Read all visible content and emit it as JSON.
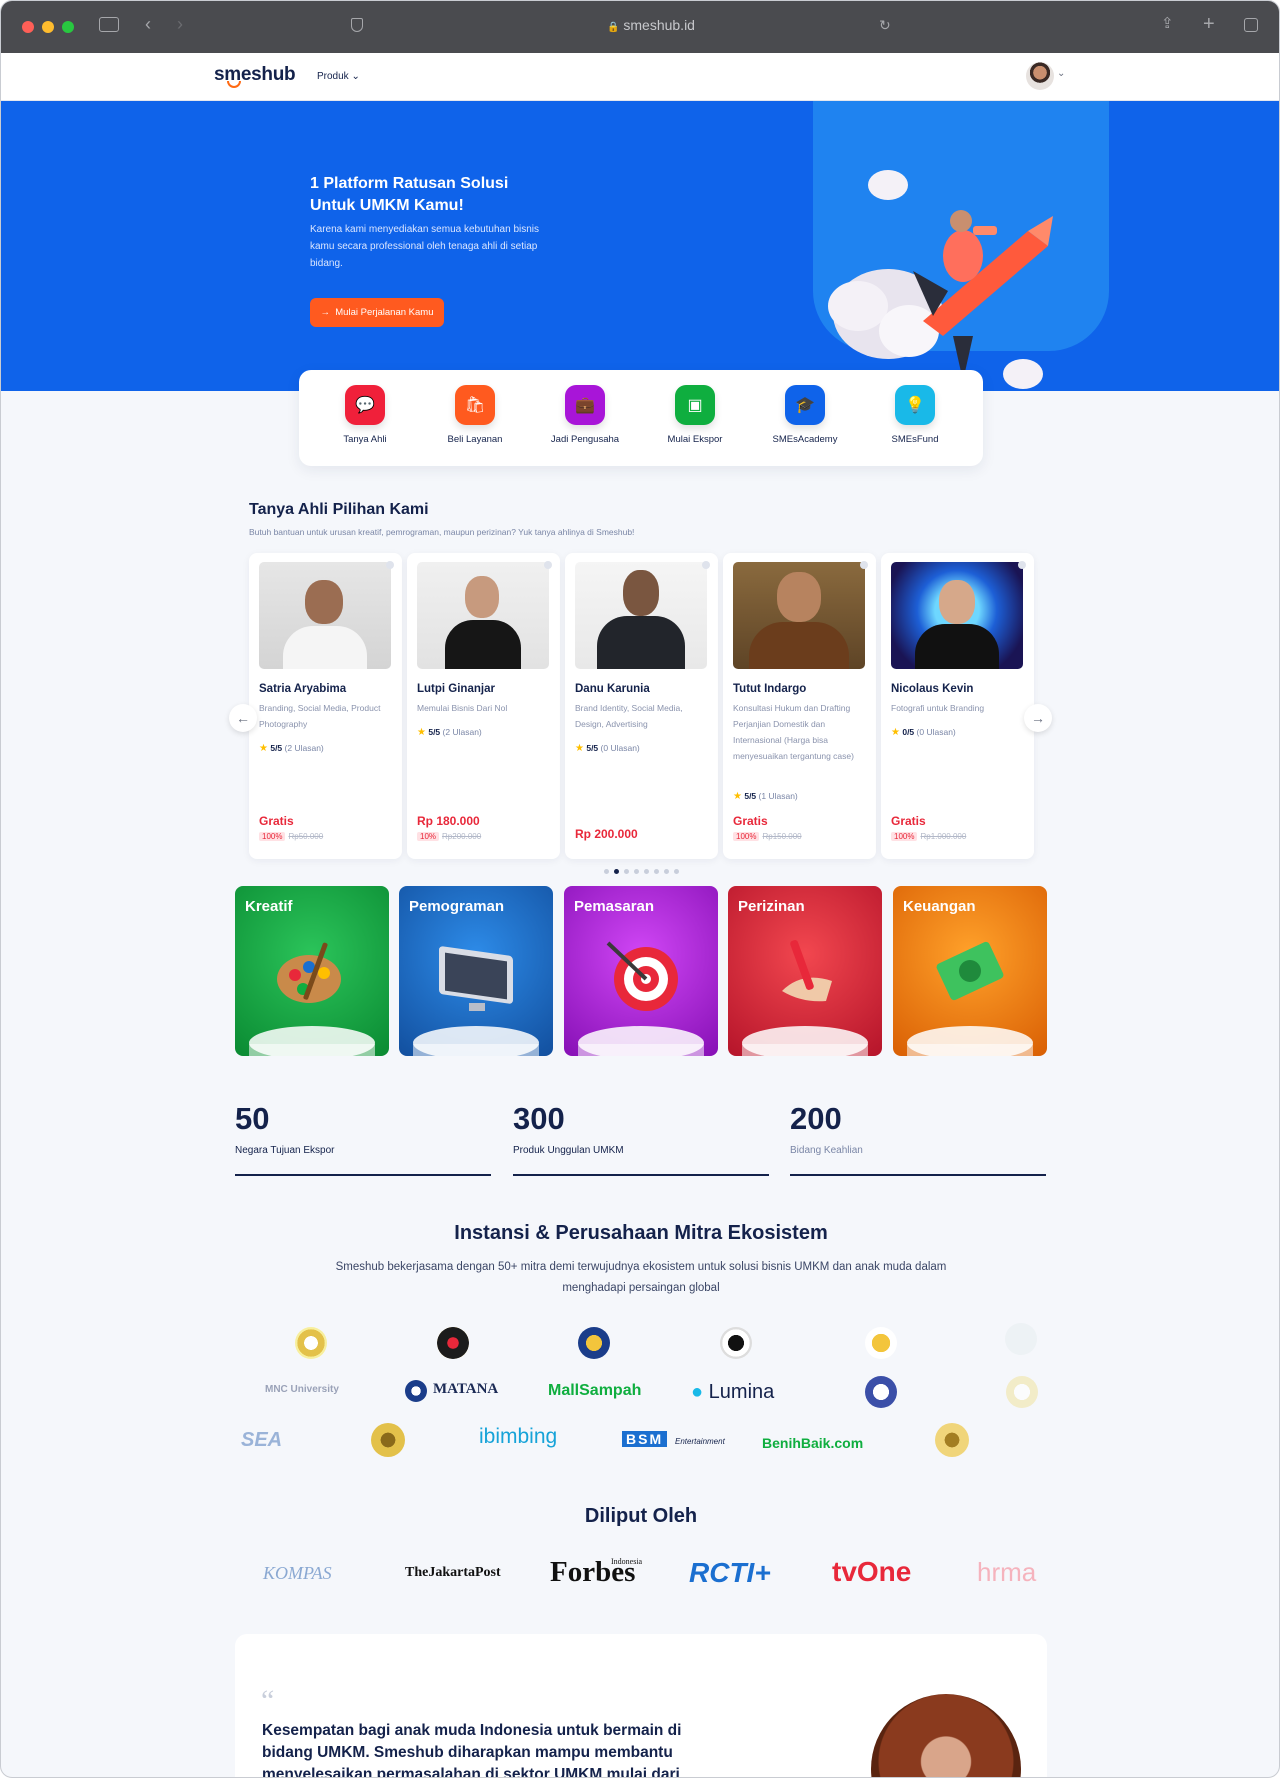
{
  "browser": {
    "url": "smeshub.id"
  },
  "nav": {
    "logo": "smeshub",
    "produk": "Produk",
    "produk_chevron": "⌄"
  },
  "hero": {
    "title": "1 Platform Ratusan Solusi Untuk UMKM Kamu!",
    "subtitle": "Karena kami menyediakan semua kebutuhan bisnis kamu secara professional oleh tenaga ahli di setiap bidang.",
    "cta": "Mulai Perjalanan Kamu"
  },
  "services": [
    {
      "label": "Tanya Ahli",
      "color": "#f0203a",
      "icon": "chat-icon"
    },
    {
      "label": "Beli Layanan",
      "color": "#ff5a1f",
      "icon": "shopping-bag-icon"
    },
    {
      "label": "Jadi Pengusaha",
      "color": "#a815d8",
      "icon": "briefcase-icon"
    },
    {
      "label": "Mulai Ekspor",
      "color": "#0fae3f",
      "icon": "box-icon"
    },
    {
      "label": "SMEsAcademy",
      "color": "#0f63ea",
      "icon": "graduation-cap-icon"
    },
    {
      "label": "SMEsFund",
      "color": "#19b9e8",
      "icon": "lightbulb-icon"
    }
  ],
  "experts": {
    "title": "Tanya Ahli Pilihan Kami",
    "subtitle": "Butuh bantuan untuk urusan kreatif, pemrograman, maupun perizinan? Yuk tanya ahlinya di Smeshub!",
    "cards": [
      {
        "name": "Satria Aryabima",
        "desc": "Branding, Social Media, Product Photography",
        "rating": "5/5",
        "reviews": "(2 Ulasan)",
        "price": "Gratis",
        "discount": "100%",
        "old_price": "Rp50.000"
      },
      {
        "name": "Lutpi Ginanjar",
        "desc": "Memulai Bisnis Dari Nol",
        "rating": "5/5",
        "reviews": "(2 Ulasan)",
        "price": "Rp 180.000",
        "discount": "10%",
        "old_price": "Rp200.000"
      },
      {
        "name": "Danu Karunia",
        "desc": "Brand Identity, Social Media, Design, Advertising",
        "rating": "5/5",
        "reviews": "(0 Ulasan)",
        "price": "Rp 200.000",
        "discount": "",
        "old_price": ""
      },
      {
        "name": "Tutut Indargo",
        "desc": "Konsultasi Hukum dan Drafting Perjanjian Domestik dan Internasional (Harga bisa menyesuaikan tergantung case)",
        "rating": "5/5",
        "reviews": "(1 Ulasan)",
        "price": "Gratis",
        "discount": "100%",
        "old_price": "Rp150.000"
      },
      {
        "name": "Nicolaus Kevin",
        "desc": "Fotografi untuk Branding",
        "rating": "0/5",
        "reviews": "(0 Ulasan)",
        "price": "Gratis",
        "discount": "100%",
        "old_price": "Rp1.000.000"
      }
    ],
    "page_count": 8,
    "active_page": 2
  },
  "categories": [
    {
      "label": "Kreatif",
      "color": "#10a53e"
    },
    {
      "label": "Pemograman",
      "color": "#1b6fd0"
    },
    {
      "label": "Pemasaran",
      "color": "#b51be0"
    },
    {
      "label": "Perizinan",
      "color": "#e02a3f"
    },
    {
      "label": "Keuangan",
      "color": "#f57c0a"
    }
  ],
  "stats": [
    {
      "value": "50",
      "label": "Negara Tujuan Ekspor"
    },
    {
      "value": "300",
      "label": "Produk Unggulan UMKM"
    },
    {
      "value": "200",
      "label": "Bidang Keahlian"
    }
  ],
  "partners": {
    "title": "Instansi & Perusahaan Mitra Ekosistem",
    "subtitle": "Smeshub bekerjasama dengan 50+ mitra demi terwujudnya ekosistem untuk solusi bisnis UMKM dan anak muda dalam menghadapi persaingan global",
    "logos": [
      "MNC University",
      "MATANA",
      "MallSampah",
      "Lumina",
      "SEA",
      "ibimbing",
      "BSM",
      "Entertainment",
      "BenihBaik.com"
    ]
  },
  "press": {
    "title": "Diliput Oleh",
    "logos": [
      "KOMPAS",
      "TheJakartaPost",
      "Forbes",
      "Indonesia",
      "RCTI+",
      "tvOne",
      "hrma"
    ]
  },
  "testimonial": {
    "quote": "Kesempatan bagi anak muda Indonesia untuk bermain di bidang UMKM. Smeshub diharapkan mampu membantu menyelesaikan permasalahan di sektor UMKM mulai dari"
  }
}
